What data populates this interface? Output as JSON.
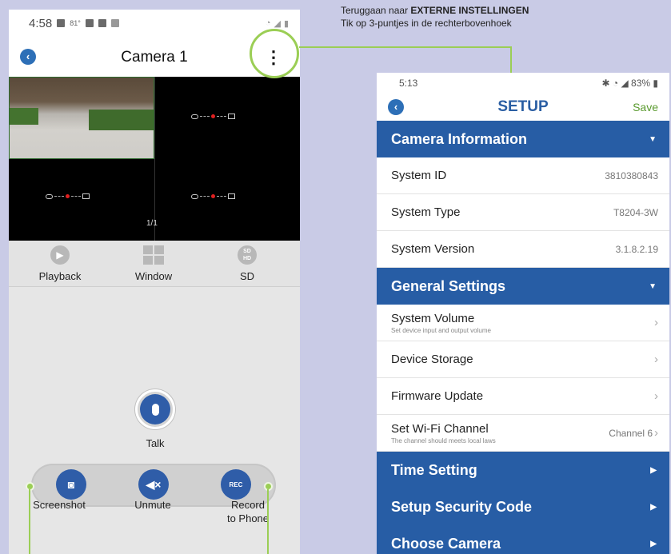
{
  "annotation": {
    "line1_prefix": "Teruggaan naar ",
    "line1_bold": "EXTERNE INSTELLINGEN",
    "line2": "Tik op 3-puntjes in de rechterbovenhoek"
  },
  "left_phone": {
    "status_time": "4:58",
    "status_temp": "81°",
    "title": "Camera 1",
    "back_glyph": "‹",
    "kebab_glyph": "⋮",
    "pager": "1/1",
    "controls": {
      "playback": "Playback",
      "window": "Window",
      "sd": "SD",
      "sd_icon_top": "SD",
      "sd_icon_bottom": "HD"
    },
    "talk_label": "Talk",
    "actions": {
      "screenshot": "Screenshot",
      "unmute": "Unmute",
      "record_line1": "Record",
      "record_line2": "to Phone",
      "rec_icon_text": "REC"
    }
  },
  "right_phone": {
    "status_time": "5:13",
    "status_battery": "83%",
    "title": "SETUP",
    "save": "Save",
    "sections": {
      "camera_info": "Camera Information",
      "general": "General Settings",
      "time": "Time Setting",
      "security": "Setup Security Code",
      "choose": "Choose Camera"
    },
    "camera_info_rows": [
      {
        "label": "System ID",
        "value": "3810380843"
      },
      {
        "label": "System Type",
        "value": "T8204-3W"
      },
      {
        "label": "System Version",
        "value": "3.1.8.2.19"
      }
    ],
    "general_rows": [
      {
        "label": "System Volume",
        "sub": "Set device input and output volume",
        "value": ""
      },
      {
        "label": "Device Storage",
        "sub": "",
        "value": ""
      },
      {
        "label": "Firmware Update",
        "sub": "",
        "value": ""
      },
      {
        "label": "Set Wi-Fi Channel",
        "sub": "The channel should meets local laws",
        "value": "Channel 6"
      }
    ]
  },
  "colors": {
    "accent_blue": "#275da5",
    "callout_green": "#9bce55",
    "save_green": "#5a9a2e"
  }
}
